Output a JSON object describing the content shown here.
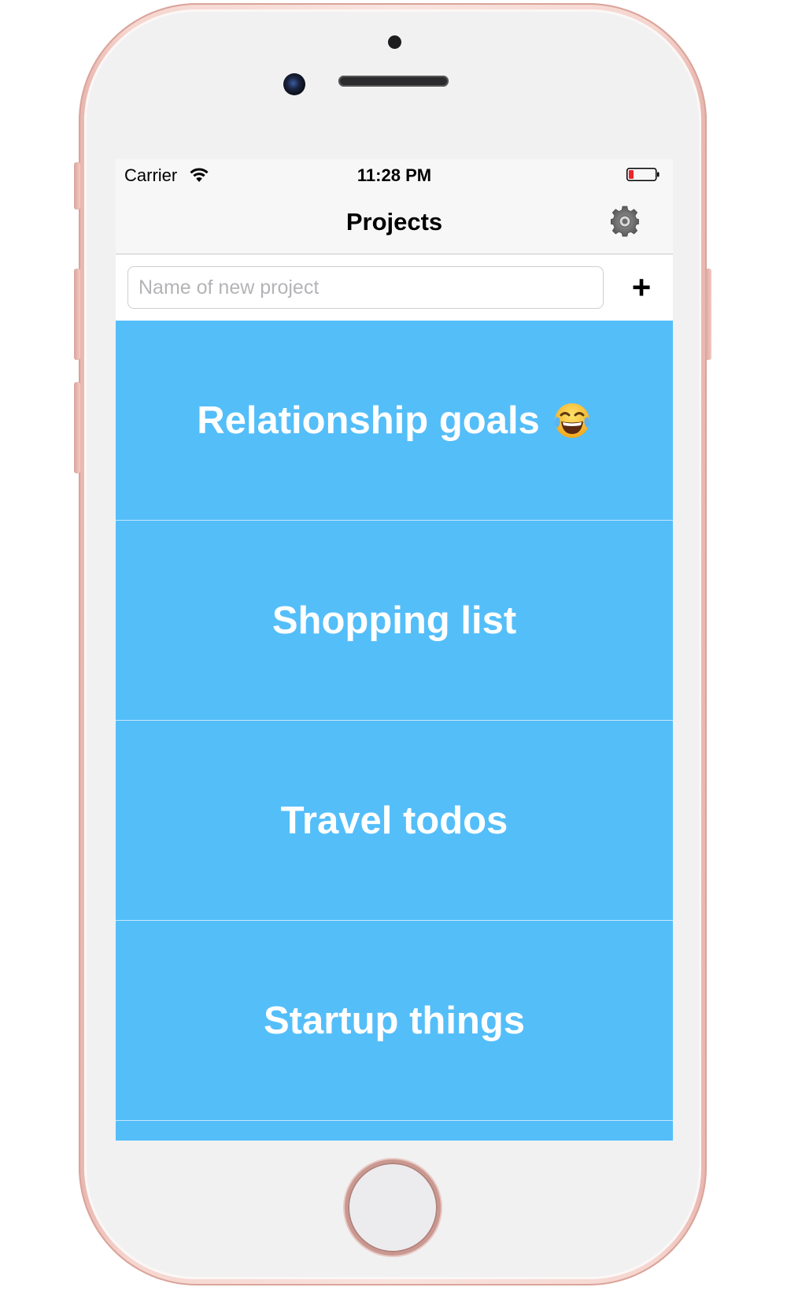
{
  "status_bar": {
    "carrier": "Carrier",
    "time": "11:28 PM",
    "wifi_icon": "wifi-icon",
    "battery_icon": "battery-low-icon",
    "battery_color": "#e8262d"
  },
  "nav": {
    "title": "Projects",
    "settings_icon": "gear-icon"
  },
  "new_project": {
    "placeholder": "Name of new project",
    "value": "",
    "add_label": "+"
  },
  "projects": [
    {
      "label": "Relationship goals",
      "emoji_icon": "tears-of-joy-emoji"
    },
    {
      "label": "Shopping list"
    },
    {
      "label": "Travel todos"
    },
    {
      "label": "Startup things"
    }
  ],
  "colors": {
    "list_background": "#54bef9",
    "list_divider": "#c4e7fc",
    "bar_background": "#f7f7f7",
    "phone_frame": "#f6d6cf"
  }
}
